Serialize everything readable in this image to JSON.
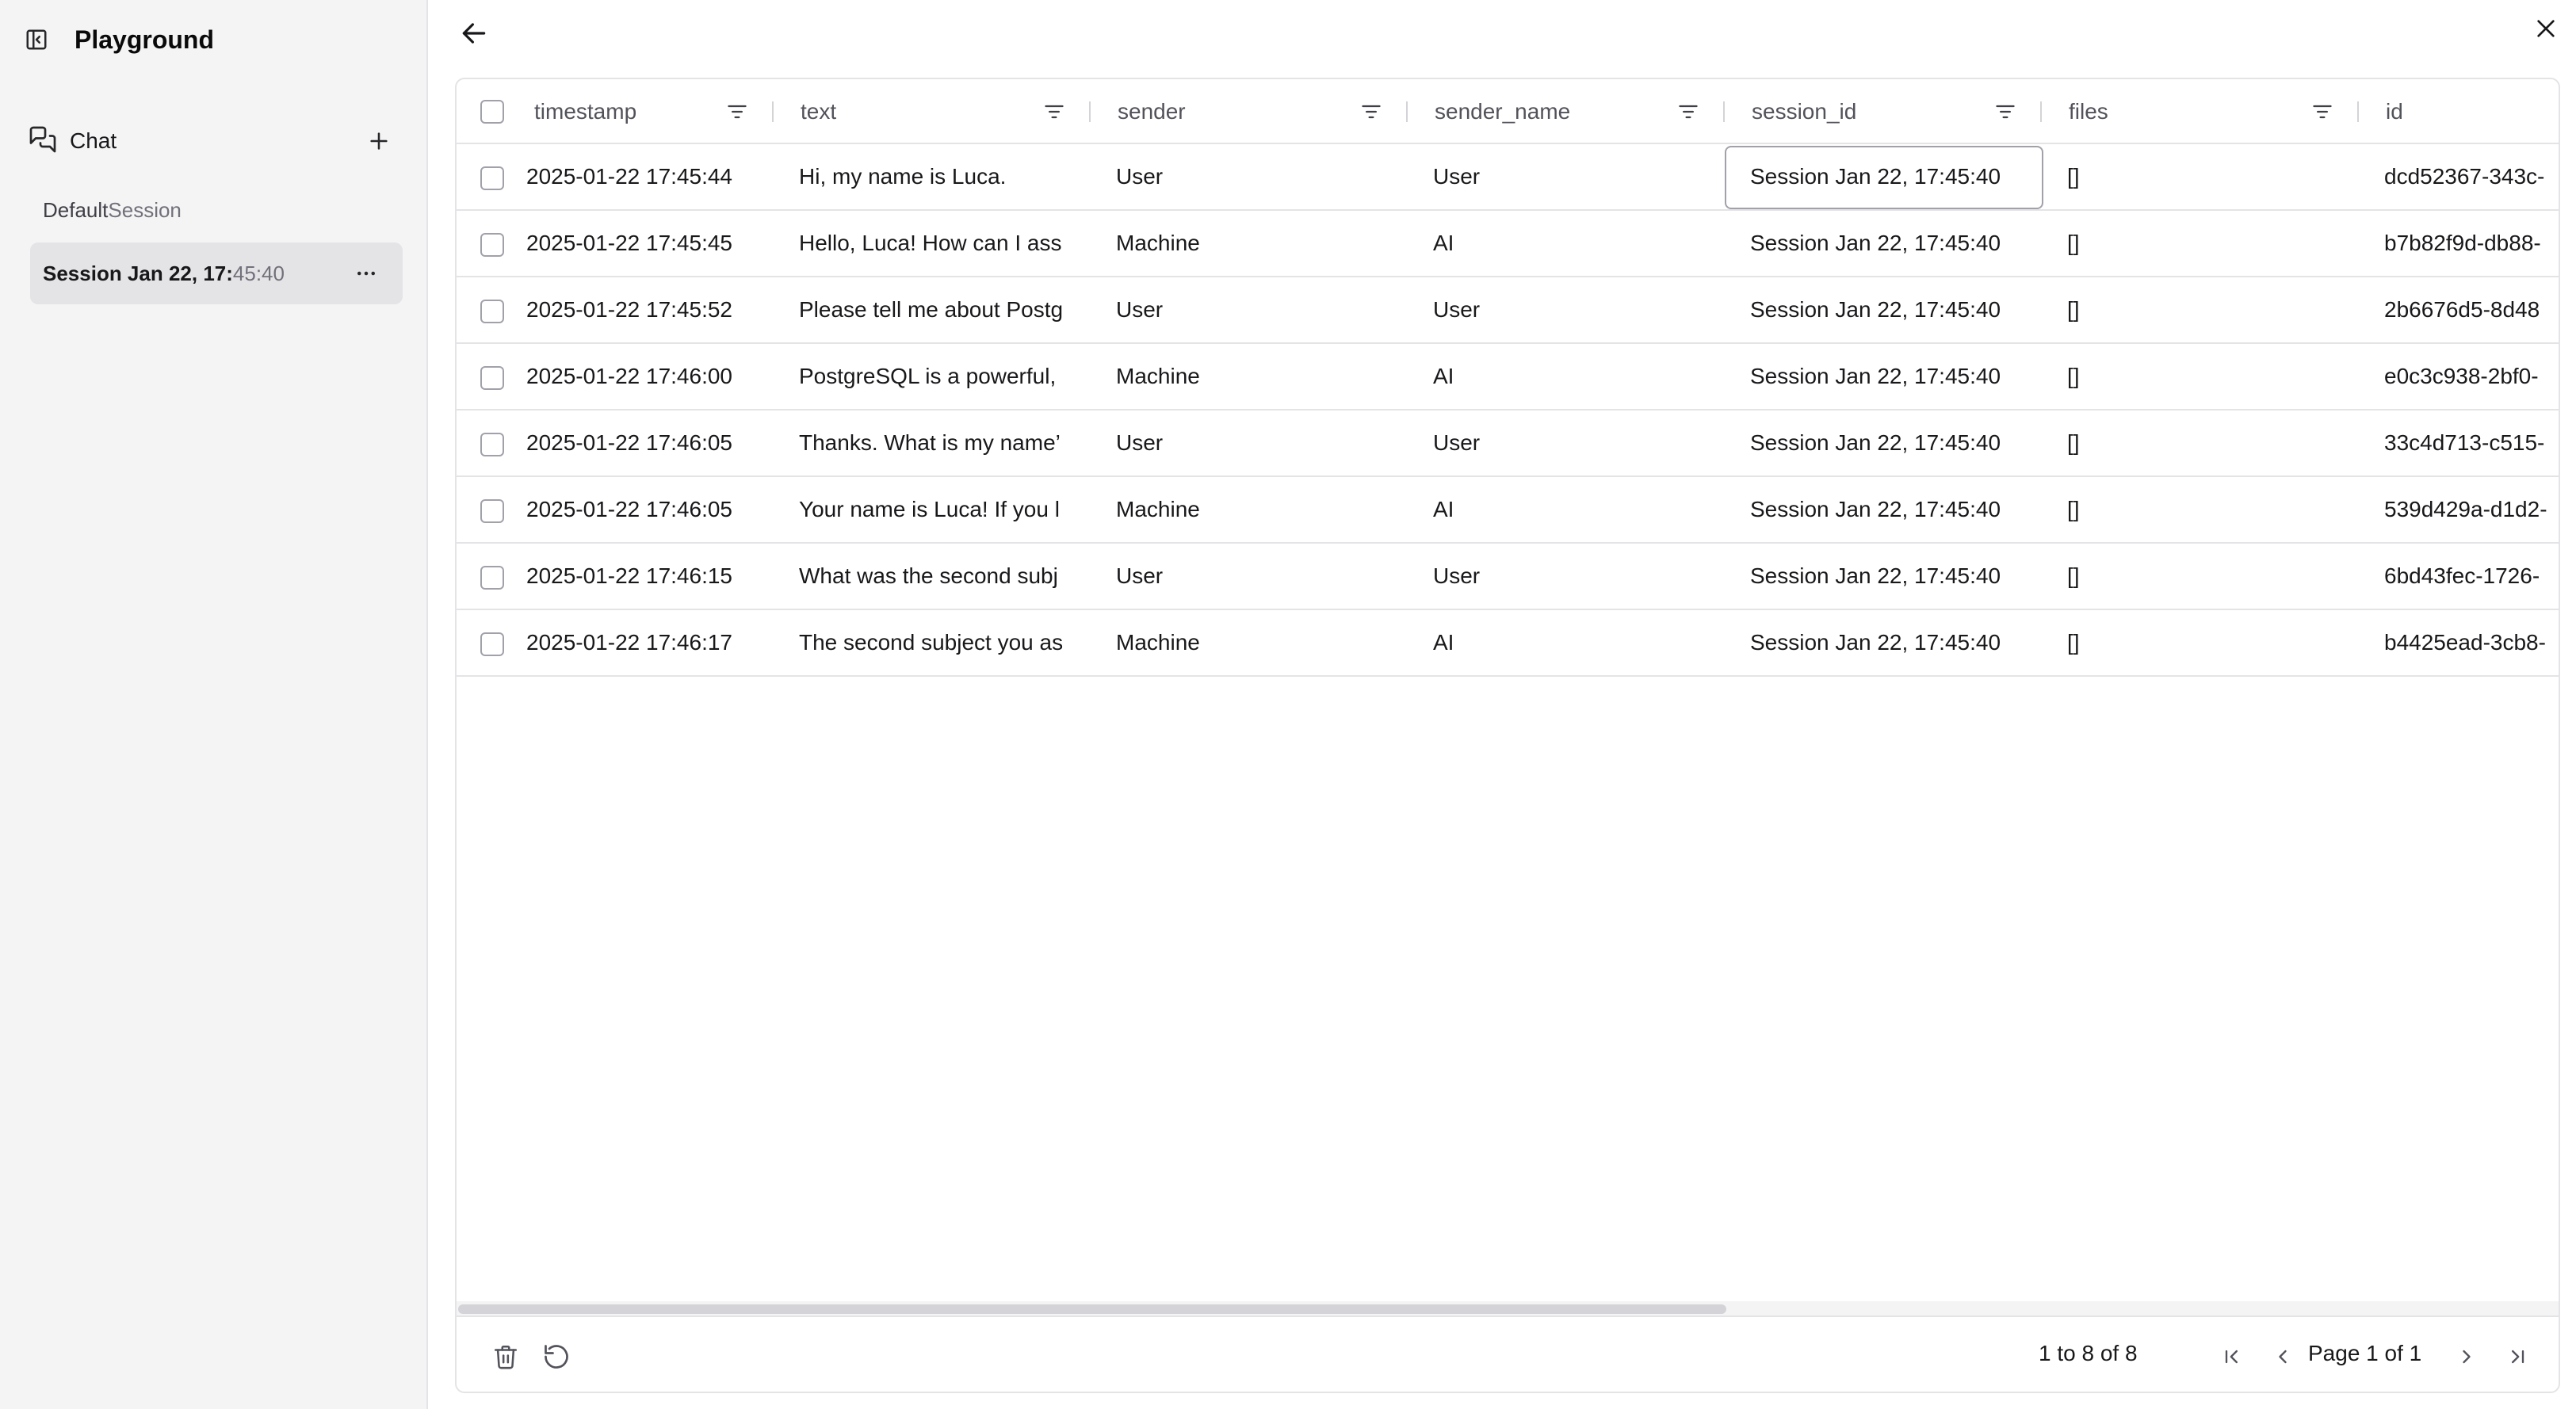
{
  "app": {
    "title": "Playground"
  },
  "sidebar": {
    "chat_label": "Chat",
    "sessions": [
      {
        "name": "Default",
        "suffix": " Session",
        "active": false
      },
      {
        "name": "Session Jan 22, 17:",
        "suffix": "45:40",
        "active": true
      }
    ]
  },
  "table": {
    "columns": [
      "timestamp",
      "text",
      "sender",
      "sender_name",
      "session_id",
      "files",
      "id"
    ],
    "rows": [
      [
        "2025-01-22 17:45:44",
        "Hi, my name is Luca.",
        "User",
        "User",
        "Session Jan 22, 17:45:40",
        "[]",
        "dcd52367-343c-"
      ],
      [
        "2025-01-22 17:45:45",
        "Hello, Luca! How can I ass",
        "Machine",
        "AI",
        "Session Jan 22, 17:45:40",
        "[]",
        "b7b82f9d-db88-"
      ],
      [
        "2025-01-22 17:45:52",
        "Please tell me about Postg",
        "User",
        "User",
        "Session Jan 22, 17:45:40",
        "[]",
        "2b6676d5-8d48"
      ],
      [
        "2025-01-22 17:46:00",
        "PostgreSQL is a powerful,",
        "Machine",
        "AI",
        "Session Jan 22, 17:45:40",
        "[]",
        "e0c3c938-2bf0-"
      ],
      [
        "2025-01-22 17:46:05",
        "Thanks. What is my name’",
        "User",
        "User",
        "Session Jan 22, 17:45:40",
        "[]",
        "33c4d713-c515-"
      ],
      [
        "2025-01-22 17:46:05",
        "Your name is Luca! If you l",
        "Machine",
        "AI",
        "Session Jan 22, 17:45:40",
        "[]",
        "539d429a-d1d2-"
      ],
      [
        "2025-01-22 17:46:15",
        "What was the second subj",
        "User",
        "User",
        "Session Jan 22, 17:45:40",
        "[]",
        "6bd43fec-1726-"
      ],
      [
        "2025-01-22 17:46:17",
        "The second subject you as",
        "Machine",
        "AI",
        "Session Jan 22, 17:45:40",
        "[]",
        "b4425ead-3cb8-"
      ]
    ]
  },
  "footer": {
    "range": "1 to 8 of 8",
    "page": "Page 1 of 1"
  },
  "icons": {
    "sidebar_toggle": "panel-left-icon",
    "chat": "messages-icon",
    "add": "plus-icon",
    "session_menu": "more-horizontal-icon",
    "back": "arrow-left-icon",
    "close": "close-icon",
    "filter": "filter-icon",
    "delete": "trash-icon",
    "refresh": "refresh-icon",
    "first_page": "first-page-icon",
    "prev_page": "chevron-left-icon",
    "next_page": "chevron-right-icon",
    "last_page": "last-page-icon"
  }
}
